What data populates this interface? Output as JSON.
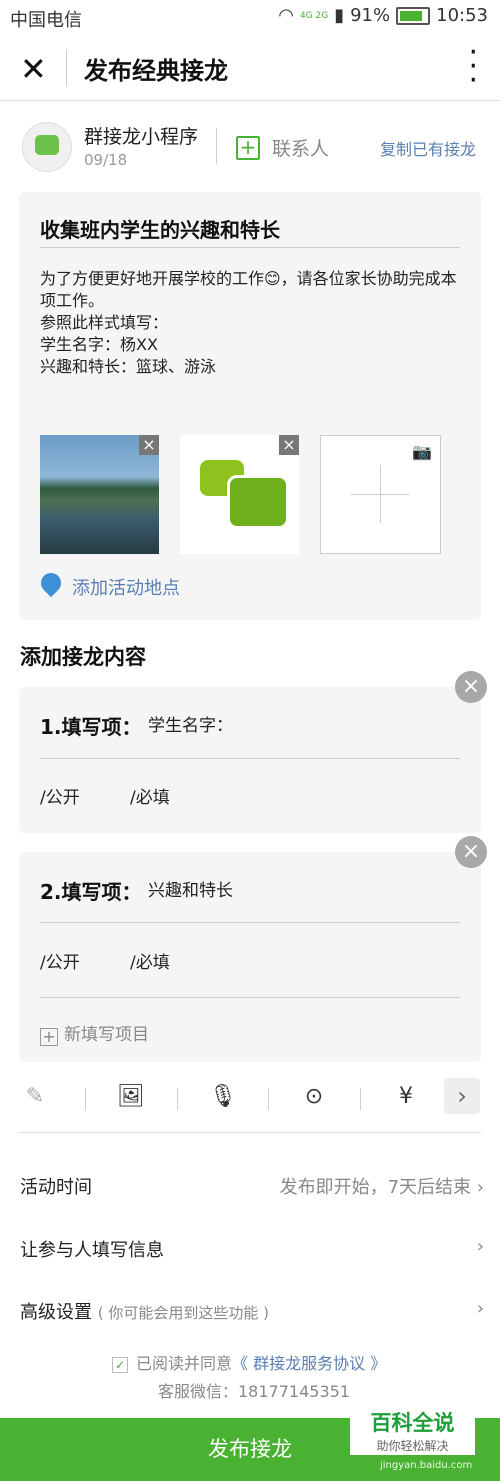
{
  "status_bar": {
    "carrier": "中国电信",
    "signal_label": "4G 2G",
    "battery": "91%",
    "time": "10:53"
  },
  "header": {
    "title": "发布经典接龙"
  },
  "publisher": {
    "name": "群接龙小程序",
    "date": "09/18",
    "contact_label": "联系人",
    "copy_label": "复制已有接龙"
  },
  "intro": {
    "title": "收集班内学生的兴趣和特长",
    "description": "为了方便更好地开展学校的工作😊，请各位家长协助完成本项工作。\n参照此样式填写：\n学生名字：杨XX\n兴趣和特长：篮球、游泳",
    "add_location": "添加活动地点"
  },
  "content_section": {
    "title": "添加接龙内容",
    "fields": [
      {
        "label": "1.填写项：",
        "value": "学生名字：",
        "public": "/公开",
        "required": "/必填"
      },
      {
        "label": "2.填写项：",
        "value": "兴趣和特长",
        "public": "/公开",
        "required": "/必填"
      }
    ],
    "new_item": "新填写项目"
  },
  "toolbar": {
    "icons": [
      "edit-icon",
      "image-icon",
      "microphone-icon",
      "location-icon",
      "yuan-icon",
      "chevron-right-icon"
    ]
  },
  "settings": {
    "activity_time": {
      "label": "活动时间",
      "value": "发布即开始，7天后结束"
    },
    "participant_info": {
      "label": "让参与人填写信息"
    },
    "advanced": {
      "label": "高级设置",
      "hint": "( 你可能会用到这些功能 )"
    }
  },
  "agreement": {
    "prefix": "已阅读并同意",
    "link": "《 群接龙服务协议 》",
    "service": "客服微信：18177145351"
  },
  "submit": {
    "label": "发布接龙"
  },
  "watermark": {
    "brand": "百科全说",
    "slogan": "助你轻松解决",
    "url": "jingyan.baidu.com"
  },
  "colors": {
    "accent": "#49b233",
    "link": "#5a7fb2",
    "card_bg": "#f5f5f5"
  }
}
